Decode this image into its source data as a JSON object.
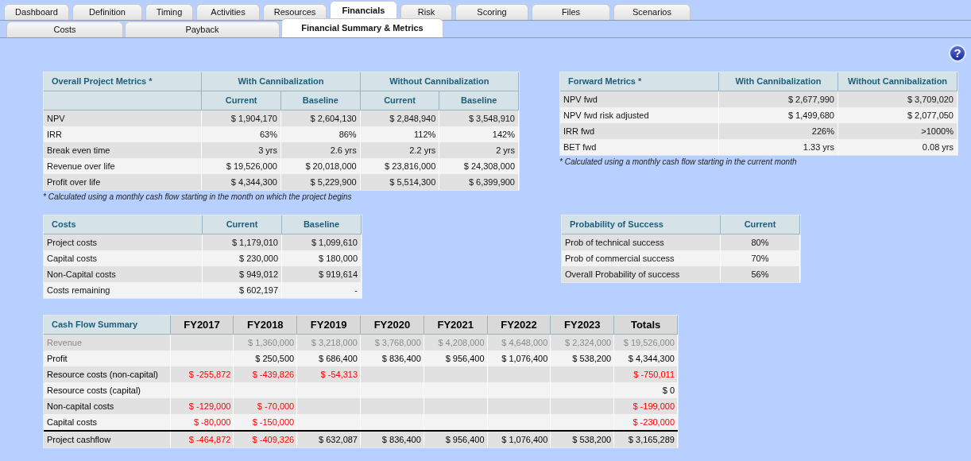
{
  "tabs": [
    {
      "label": "Dashboard",
      "selected": false
    },
    {
      "label": "Definition",
      "selected": false
    },
    {
      "label": "Timing",
      "selected": false
    },
    {
      "label": "Activities",
      "selected": false
    },
    {
      "label": "Resources",
      "selected": false
    },
    {
      "label": "Financials",
      "selected": true
    },
    {
      "label": "Risk",
      "selected": false
    },
    {
      "label": "Scoring",
      "selected": false
    },
    {
      "label": "Files",
      "selected": false
    },
    {
      "label": "Scenarios",
      "selected": false
    }
  ],
  "subtabs": [
    {
      "label": "Costs",
      "selected": false
    },
    {
      "label": "Payback",
      "selected": false
    },
    {
      "label": "Financial Summary & Metrics",
      "selected": true
    }
  ],
  "help_button": {
    "label": "?"
  },
  "overall_metrics": {
    "title": "Overall Project Metrics *",
    "groups": [
      "With Cannibalization",
      "Without Cannibalization"
    ],
    "columns": [
      "Current",
      "Baseline",
      "Current",
      "Baseline"
    ],
    "rows": [
      {
        "label": "NPV",
        "values": [
          "$ 1,904,170",
          "$ 2,604,130",
          "$ 2,848,940",
          "$ 3,548,910"
        ]
      },
      {
        "label": "IRR",
        "values": [
          "63%",
          "86%",
          "112%",
          "142%"
        ]
      },
      {
        "label": "Break even time",
        "values": [
          "3 yrs",
          "2.6 yrs",
          "2.2 yrs",
          "2 yrs"
        ]
      },
      {
        "label": "Revenue over life",
        "values": [
          "$ 19,526,000",
          "$ 20,018,000",
          "$ 23,816,000",
          "$ 24,308,000"
        ]
      },
      {
        "label": "Profit over life",
        "values": [
          "$ 4,344,300",
          "$ 5,229,900",
          "$ 5,514,300",
          "$ 6,399,900"
        ]
      }
    ],
    "note": "* Calculated using a monthly cash flow starting in the month on which the project begins"
  },
  "forward_metrics": {
    "title": "Forward Metrics *",
    "columns": [
      "With Cannibalization",
      "Without Cannibalization"
    ],
    "rows": [
      {
        "label": "NPV fwd",
        "values": [
          "$ 2,677,990",
          "$ 3,709,020"
        ]
      },
      {
        "label": "NPV fwd risk adjusted",
        "values": [
          "$ 1,499,680",
          "$ 2,077,050"
        ]
      },
      {
        "label": "IRR fwd",
        "values": [
          "226%",
          ">1000%"
        ]
      },
      {
        "label": "BET fwd",
        "values": [
          "1.33 yrs",
          "0.08 yrs"
        ]
      }
    ],
    "note": "* Calculated using a monthly cash flow starting in the current month"
  },
  "costs": {
    "title": "Costs",
    "columns": [
      "Current",
      "Baseline"
    ],
    "rows": [
      {
        "label": "Project costs",
        "values": [
          "$ 1,179,010",
          "$ 1,099,610"
        ]
      },
      {
        "label": "Capital costs",
        "values": [
          "$ 230,000",
          "$ 180,000"
        ]
      },
      {
        "label": "Non-Capital costs",
        "values": [
          "$ 949,012",
          "$ 919,614"
        ]
      },
      {
        "label": "Costs remaining",
        "values": [
          "$ 602,197",
          "-"
        ]
      }
    ]
  },
  "probability": {
    "title": "Probability of Success",
    "columns": [
      "Current"
    ],
    "rows": [
      {
        "label": "Prob of technical success",
        "values": [
          "80%"
        ]
      },
      {
        "label": "Prob of commercial success",
        "values": [
          "70%"
        ]
      },
      {
        "label": "Overall Probability of success",
        "values": [
          "56%"
        ]
      }
    ]
  },
  "cash_flow": {
    "title": "Cash Flow Summary",
    "columns": [
      "FY2017",
      "FY2018",
      "FY2019",
      "FY2020",
      "FY2021",
      "FY2022",
      "FY2023",
      "Totals"
    ],
    "rows": [
      {
        "label": "Revenue",
        "kind": "muted",
        "cells": [
          null,
          {
            "text": "$ 1,360,000",
            "negative": false
          },
          {
            "text": "$ 3,218,000",
            "negative": false
          },
          {
            "text": "$ 3,768,000",
            "negative": false
          },
          {
            "text": "$ 4,208,000",
            "negative": false
          },
          {
            "text": "$ 4,648,000",
            "negative": false
          },
          {
            "text": "$ 2,324,000",
            "negative": false
          },
          {
            "text": "$ 19,526,000",
            "negative": false
          }
        ]
      },
      {
        "label": "Profit",
        "kind": "normal",
        "cells": [
          null,
          {
            "text": "$ 250,500",
            "negative": false
          },
          {
            "text": "$ 686,400",
            "negative": false
          },
          {
            "text": "$ 836,400",
            "negative": false
          },
          {
            "text": "$ 956,400",
            "negative": false
          },
          {
            "text": "$ 1,076,400",
            "negative": false
          },
          {
            "text": "$ 538,200",
            "negative": false
          },
          {
            "text": "$ 4,344,300",
            "negative": false
          }
        ]
      },
      {
        "label": "Resource costs (non-capital)",
        "kind": "normal",
        "cells": [
          {
            "text": "$ -255,872",
            "negative": true
          },
          {
            "text": "$ -439,826",
            "negative": true
          },
          {
            "text": "$ -54,313",
            "negative": true
          },
          null,
          null,
          null,
          null,
          {
            "text": "$ -750,011",
            "negative": true
          }
        ]
      },
      {
        "label": "Resource costs (capital)",
        "kind": "normal",
        "cells": [
          null,
          null,
          null,
          null,
          null,
          null,
          null,
          {
            "text": "$ 0",
            "negative": false
          }
        ]
      },
      {
        "label": "Non-capital costs",
        "kind": "normal",
        "cells": [
          {
            "text": "$ -129,000",
            "negative": true
          },
          {
            "text": "$ -70,000",
            "negative": true
          },
          null,
          null,
          null,
          null,
          null,
          {
            "text": "$ -199,000",
            "negative": true
          }
        ]
      },
      {
        "label": "Capital costs",
        "kind": "normal",
        "cells": [
          {
            "text": "$ -80,000",
            "negative": true
          },
          {
            "text": "$ -150,000",
            "negative": true
          },
          null,
          null,
          null,
          null,
          null,
          {
            "text": "$ -230,000",
            "negative": true
          }
        ]
      },
      {
        "label": "Project cashflow",
        "kind": "total",
        "cells": [
          {
            "text": "$ -464,872",
            "negative": true
          },
          {
            "text": "$ -409,326",
            "negative": true
          },
          {
            "text": "$ 632,087",
            "negative": false
          },
          {
            "text": "$ 836,400",
            "negative": false
          },
          {
            "text": "$ 956,400",
            "negative": false
          },
          {
            "text": "$ 1,076,400",
            "negative": false
          },
          {
            "text": "$ 538,200",
            "negative": false
          },
          {
            "text": "$ 3,165,289",
            "negative": false
          }
        ]
      }
    ]
  }
}
